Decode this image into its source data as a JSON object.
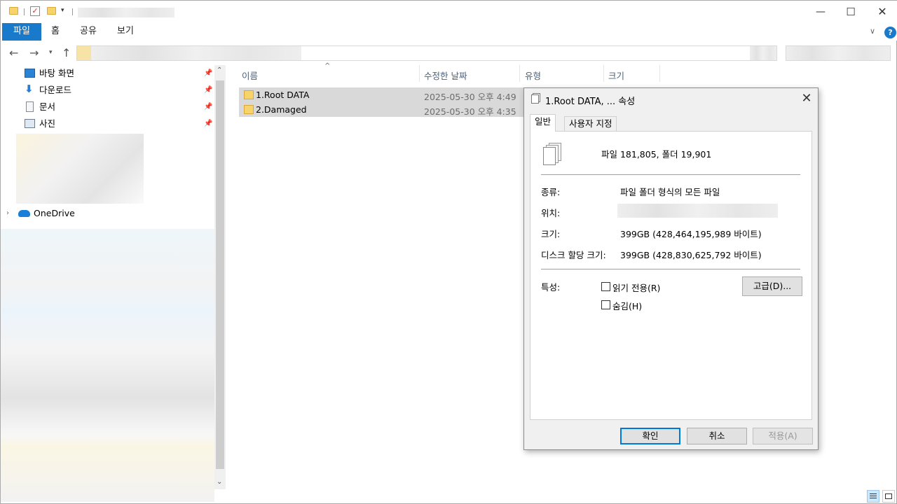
{
  "ribbon": {
    "tabs": [
      "파일",
      "홈",
      "공유",
      "보기"
    ]
  },
  "nav": {
    "quick_access": [
      {
        "label": "바탕 화면",
        "icon": "desktop-icon"
      },
      {
        "label": "다운로드",
        "icon": "download-icon"
      },
      {
        "label": "문서",
        "icon": "document-icon"
      },
      {
        "label": "사진",
        "icon": "picture-icon"
      }
    ],
    "onedrive": "OneDrive"
  },
  "filelist": {
    "columns": [
      "이름",
      "수정한 날짜",
      "유형",
      "크기"
    ],
    "rows": [
      {
        "name": "1.Root DATA",
        "date": "2025-05-30 오후 4:49"
      },
      {
        "name": "2.Damaged",
        "date": "2025-05-30 오후 4:35"
      }
    ]
  },
  "dialog": {
    "title": "1.Root DATA, ... 속성",
    "tabs": [
      "일반",
      "사용자 지정"
    ],
    "summary": "파일 181,805, 폴더 19,901",
    "rows": [
      {
        "label": "종류:",
        "value": "파일 폴더 형식의 모든 파일"
      },
      {
        "label": "위치:",
        "value": ""
      },
      {
        "label": "크기:",
        "value": "399GB (428,464,195,989 바이트)"
      },
      {
        "label": "디스크 할당 크기:",
        "value": "399GB (428,830,625,792 바이트)"
      }
    ],
    "attributes_label": "특성:",
    "readonly_label": "읽기 전용(R)",
    "hidden_label": "숨김(H)",
    "advanced_label": "고급(D)...",
    "ok_label": "확인",
    "cancel_label": "취소",
    "apply_label": "적용(A)"
  },
  "colors": {
    "accent": "#1979ca",
    "selection": "#d9d9d9",
    "folder": "#f6d36b"
  }
}
